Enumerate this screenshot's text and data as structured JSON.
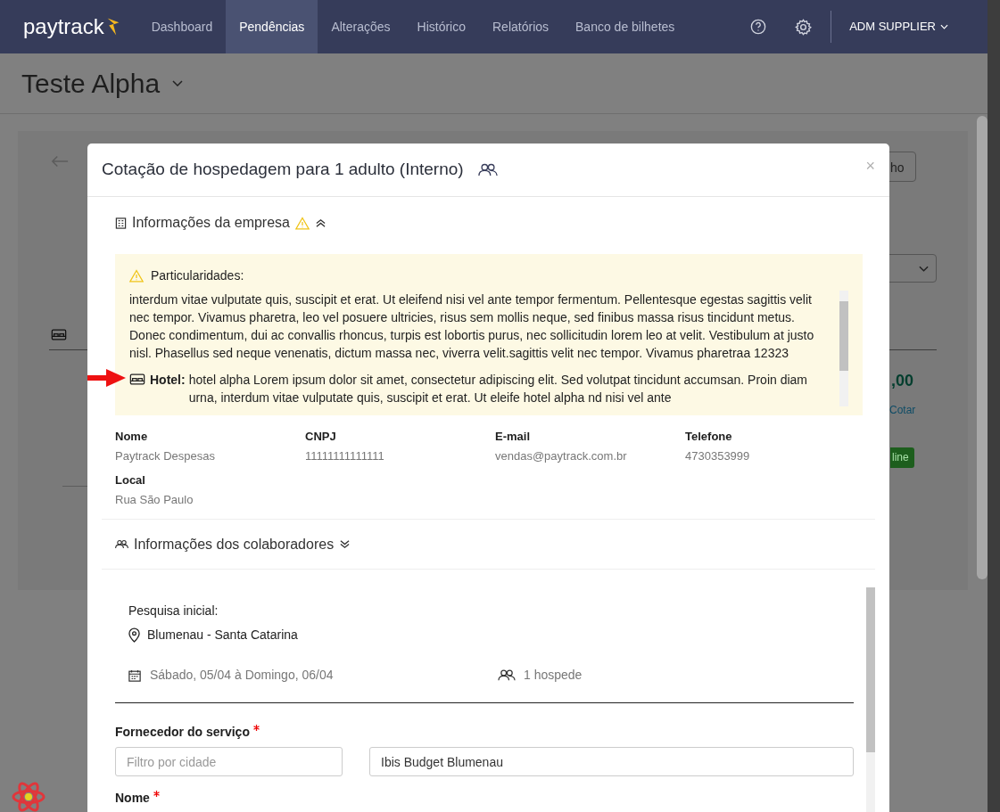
{
  "nav": {
    "logo": "paytrack",
    "items": [
      {
        "label": "Dashboard",
        "selected": false
      },
      {
        "label": "Pendências",
        "selected": true
      },
      {
        "label": "Alterações",
        "selected": false
      },
      {
        "label": "Histórico",
        "selected": false
      },
      {
        "label": "Relatórios",
        "selected": false
      },
      {
        "label": "Banco de bilhetes",
        "selected": false
      }
    ],
    "user": "ADM SUPPLIER"
  },
  "page": {
    "title": "Teste Alpha"
  },
  "background": {
    "amount": ",00",
    "link": "Cotar",
    "badge": "line",
    "button": "ho"
  },
  "modal": {
    "title": "Cotação de hospedagem para 1 adulto (Interno)",
    "close": "×",
    "company_section": {
      "title": "Informações da empresa",
      "expanded": true,
      "warning": true,
      "notice": {
        "heading": "Particularidades:",
        "text": "interdum vitae vulputate quis, suscipit et erat. Ut eleifend nisi vel ante tempor fermentum. Pellentesque egestas sagittis velit nec tempor. Vivamus pharetra, leo vel posuere ultricies, risus sem mollis neque, sed finibus massa risus tincidunt metus. Donec condimentum, dui ac convallis rhoncus, turpis est lobortis purus, nec sollicitudin lorem leo at velit. Vestibulum at justo nisl. Phasellus sed neque venenatis, dictum massa nec, viverra velit.sagittis velit nec tempor. Vivamus pharetraa 12323",
        "hotel_label": "Hotel:",
        "hotel_text": "hotel alpha Lorem ipsum dolor sit amet, consectetur adipiscing elit. Sed volutpat tincidunt accumsan. Proin diam urna, interdum vitae vulputate quis, suscipit et erat. Ut eleife hotel alpha nd nisi vel ante"
      },
      "fields": [
        {
          "label": "Nome",
          "value": "Paytrack Despesas"
        },
        {
          "label": "CNPJ",
          "value": "11111111111111"
        },
        {
          "label": "E-mail",
          "value": "vendas@paytrack.com.br"
        },
        {
          "label": "Telefone",
          "value": "4730353999"
        },
        {
          "label": "Local",
          "value": "Rua São Paulo"
        }
      ]
    },
    "collaborators_section": {
      "title": "Informações dos colaboradores",
      "expanded": false
    },
    "search": {
      "heading": "Pesquisa inicial:",
      "location": "Blumenau - Santa Catarina",
      "dates": "Sábado, 05/04 à Domingo, 06/04",
      "guests": "1 hospede"
    },
    "supplier": {
      "label": "Fornecedor do serviço",
      "required": true,
      "city_filter": {
        "placeholder": "Filtro por cidade"
      },
      "hotel": {
        "value": "Ibis Budget Blumenau"
      }
    },
    "next_field": {
      "label": "Nome",
      "required": true
    }
  }
}
